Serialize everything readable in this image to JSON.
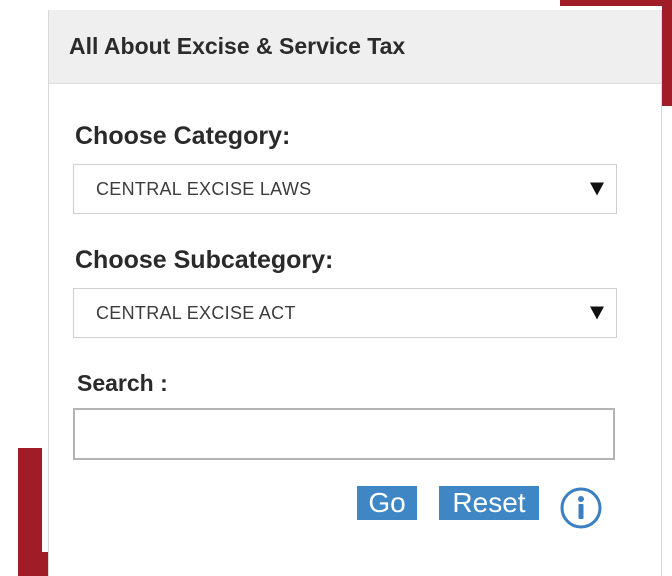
{
  "colors": {
    "accent_maroon": "#a01c26",
    "button_blue": "#3f86c4",
    "info_blue": "#3a7fc1"
  },
  "panel": {
    "title": "All About Excise & Service Tax"
  },
  "form": {
    "category": {
      "label": "Choose Category:",
      "selected": "CENTRAL EXCISE LAWS"
    },
    "subcategory": {
      "label": "Choose Subcategory:",
      "selected": "CENTRAL EXCISE ACT"
    },
    "search": {
      "label": "Search :",
      "value": ""
    },
    "buttons": {
      "go_label": "Go",
      "reset_label": "Reset"
    },
    "icons": {
      "info": "info-icon",
      "dropdown": "caret-down-icon"
    }
  }
}
